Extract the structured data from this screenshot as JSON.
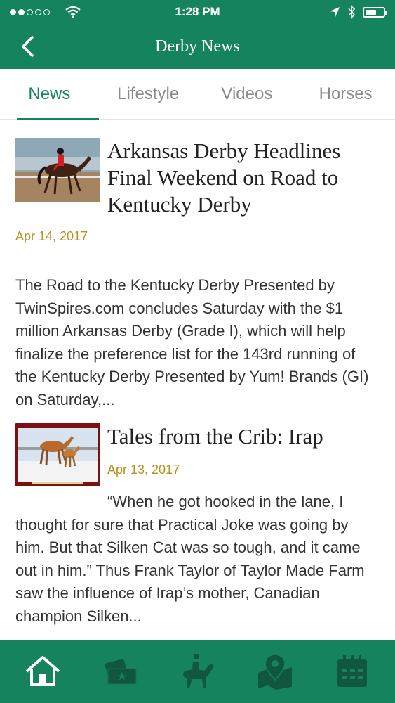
{
  "status_bar": {
    "time": "1:28 PM"
  },
  "header": {
    "title": "Derby News",
    "back_icon": "chevron-left-icon"
  },
  "tabs": [
    {
      "label": "News",
      "active": true
    },
    {
      "label": "Lifestyle",
      "active": false
    },
    {
      "label": "Videos",
      "active": false
    },
    {
      "label": "Horses",
      "active": false
    }
  ],
  "articles": [
    {
      "title": "Arkansas Derby Headlines Final Weekend on Road to Kentucky Derby",
      "date": "Apr 14, 2017",
      "excerpt": "The Road to the Kentucky Derby Presented by TwinSpires.com concludes Saturday with the $1 million Arkansas Derby (Grade I), which will help finalize the preference list for the 143rd running of the Kentucky Derby Presented by Yum! Brands (GI) on Saturday,..."
    },
    {
      "title": "Tales from the Crib: Irap",
      "date": "Apr 13, 2017",
      "excerpt": "“When he got hooked in the lane, I thought for sure that Practical Joke was going by him. But that Silken Cat was so tough, and it came out in him.” Thus Frank Taylor of Taylor Made Farm saw the influence of Irap’s mother, Canadian champion Silken..."
    }
  ],
  "bottom_tabs": [
    "home-icon",
    "tickets-icon",
    "horse-rider-icon",
    "map-icon",
    "calendar-icon"
  ],
  "colors": {
    "brand_green": "#16835f",
    "date_gold": "#b8901e",
    "tab_inactive": "#8b8b8b"
  }
}
